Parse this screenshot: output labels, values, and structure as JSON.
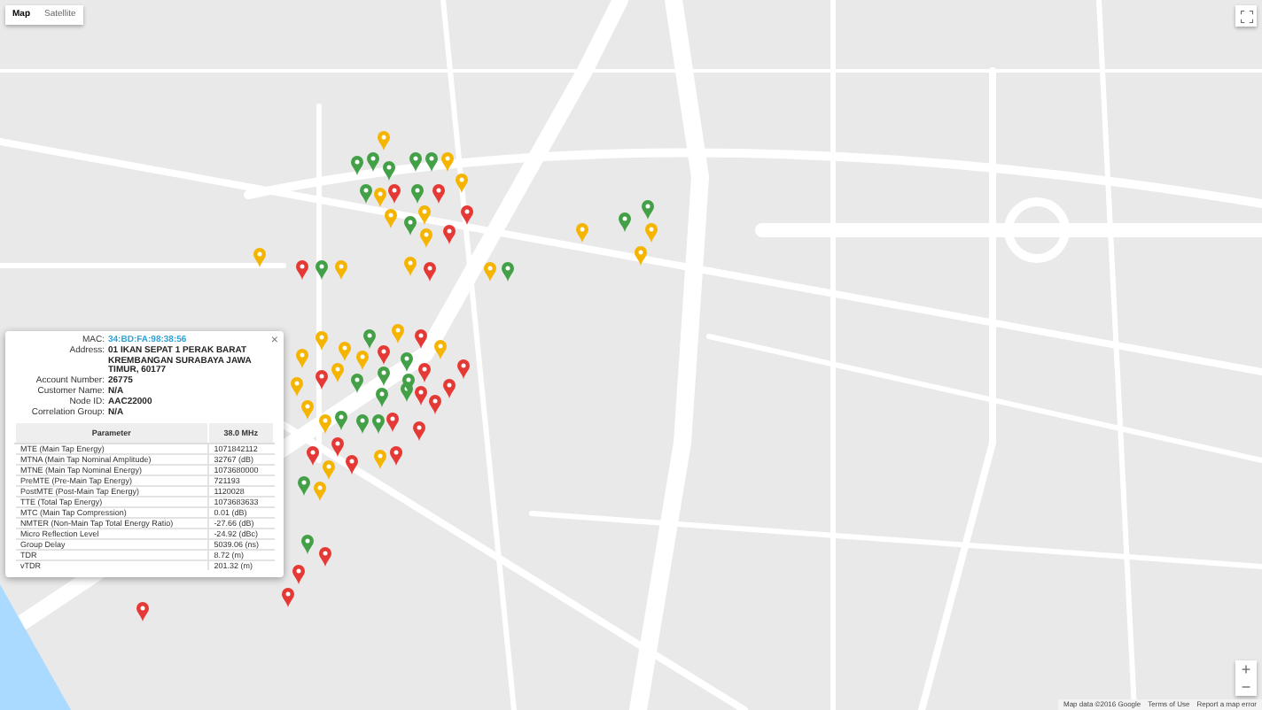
{
  "map_type": [
    {
      "label": "Map",
      "selected": true
    },
    {
      "label": "Satellite",
      "selected": false
    }
  ],
  "markers": [
    {
      "color": "#43a047"
    },
    {
      "color": "#43a047"
    },
    {
      "color": "#43a047"
    },
    {
      "color": "#43a047"
    },
    {
      "color": "#f4b400"
    },
    {
      "color": "#43a047"
    },
    {
      "color": "#43a047"
    },
    {
      "color": "#f4b400"
    },
    {
      "color": "#e53935"
    },
    {
      "color": "#43a047"
    },
    {
      "color": "#e53935"
    },
    {
      "color": "#43a047"
    },
    {
      "color": "#f4b400"
    },
    {
      "color": "#f4b400"
    },
    {
      "color": "#f4b400"
    },
    {
      "color": "#f4b400"
    },
    {
      "color": "#e53935"
    },
    {
      "color": "#f4b400"
    },
    {
      "color": "#e53935"
    },
    {
      "color": "#e53935"
    },
    {
      "color": "#f4b400"
    },
    {
      "color": "#e53935"
    },
    {
      "color": "#43a047"
    },
    {
      "color": "#f4b400"
    },
    {
      "color": "#f4b400"
    },
    {
      "color": "#f4b400"
    },
    {
      "color": "#43a047"
    },
    {
      "color": "#f4b400"
    },
    {
      "color": "#43a047"
    },
    {
      "color": "#43a047"
    },
    {
      "color": "#f4b400"
    },
    {
      "color": "#f4b400"
    },
    {
      "color": "#f4b400"
    },
    {
      "color": "#43a047"
    },
    {
      "color": "#e53935"
    },
    {
      "color": "#f4b400"
    },
    {
      "color": "#e53935"
    },
    {
      "color": "#f4b400"
    },
    {
      "color": "#e53935"
    },
    {
      "color": "#f4b400"
    },
    {
      "color": "#f4b400"
    },
    {
      "color": "#f4b400"
    },
    {
      "color": "#43a047"
    },
    {
      "color": "#e53935"
    },
    {
      "color": "#43a047"
    },
    {
      "color": "#f4b400"
    },
    {
      "color": "#e53935"
    },
    {
      "color": "#43a047"
    },
    {
      "color": "#e53935"
    },
    {
      "color": "#43a047"
    },
    {
      "color": "#43a047"
    },
    {
      "color": "#43a047"
    },
    {
      "color": "#e53935"
    },
    {
      "color": "#e53935"
    },
    {
      "color": "#e53935"
    },
    {
      "color": "#43a047"
    },
    {
      "color": "#f4b400"
    },
    {
      "color": "#43a047"
    },
    {
      "color": "#f4b400"
    },
    {
      "color": "#f4b400"
    },
    {
      "color": "#f4b400"
    },
    {
      "color": "#e53935"
    },
    {
      "color": "#e53935"
    },
    {
      "color": "#e53935"
    },
    {
      "color": "#f4b400"
    },
    {
      "color": "#43a047"
    },
    {
      "color": "#f4b400"
    },
    {
      "color": "#e53935"
    },
    {
      "color": "#43a047"
    },
    {
      "color": "#e53935"
    },
    {
      "color": "#e53935"
    },
    {
      "color": "#e53935"
    },
    {
      "color": "#e53935"
    },
    {
      "color": "#43a047"
    },
    {
      "color": "#e53935"
    }
  ],
  "info_window": {
    "fields": [
      {
        "label": "MAC:",
        "value": "34:BD:FA:98:38:56",
        "kind": "link"
      },
      {
        "label": "Address:",
        "value": "01 IKAN SEPAT 1 PERAK BARAT KREMBANGAN SURABAYA JAWA TIMUR, 60177",
        "kind": "text"
      },
      {
        "label": "Account Number:",
        "value": "26775",
        "kind": "text"
      },
      {
        "label": "Customer Name:",
        "value": "N/A",
        "kind": "text"
      },
      {
        "label": "Node ID:",
        "value": "AAC22000",
        "kind": "text"
      },
      {
        "label": "Correlation Group:",
        "value": "N/A",
        "kind": "text"
      }
    ],
    "close": "×",
    "table": {
      "columns": [
        "Parameter",
        "38.0 MHz"
      ],
      "rows": [
        [
          "MTE (Main Tap Energy)",
          "1071842112"
        ],
        [
          "MTNA (Main Tap Nominal Amplitude)",
          "32767 (dB)"
        ],
        [
          "MTNE (Main Tap Nominal Energy)",
          "1073680000"
        ],
        [
          "PreMTE (Pre-Main Tap Energy)",
          "721193"
        ],
        [
          "PostMTE (Post-Main Tap Energy)",
          "1120028"
        ],
        [
          "TTE (Total Tap Energy)",
          "1073683633"
        ],
        [
          "MTC (Main Tap Compression)",
          "0.01 (dB)"
        ],
        [
          "NMTER (Non-Main Tap Total Energy Ratio)",
          "-27.66 (dB)"
        ],
        [
          "Micro Reflection Level",
          "-24.92 (dBc)"
        ],
        [
          "Group Delay",
          "5039.06 (ns)"
        ],
        [
          "TDR",
          "8.72 (m)"
        ],
        [
          "vTDR",
          "201.32 (m)"
        ]
      ]
    }
  },
  "zoom": {
    "in": "+",
    "out": "−"
  },
  "footer": [
    "Map data ©2016 Google",
    "Terms of Use",
    "Report a map error"
  ]
}
